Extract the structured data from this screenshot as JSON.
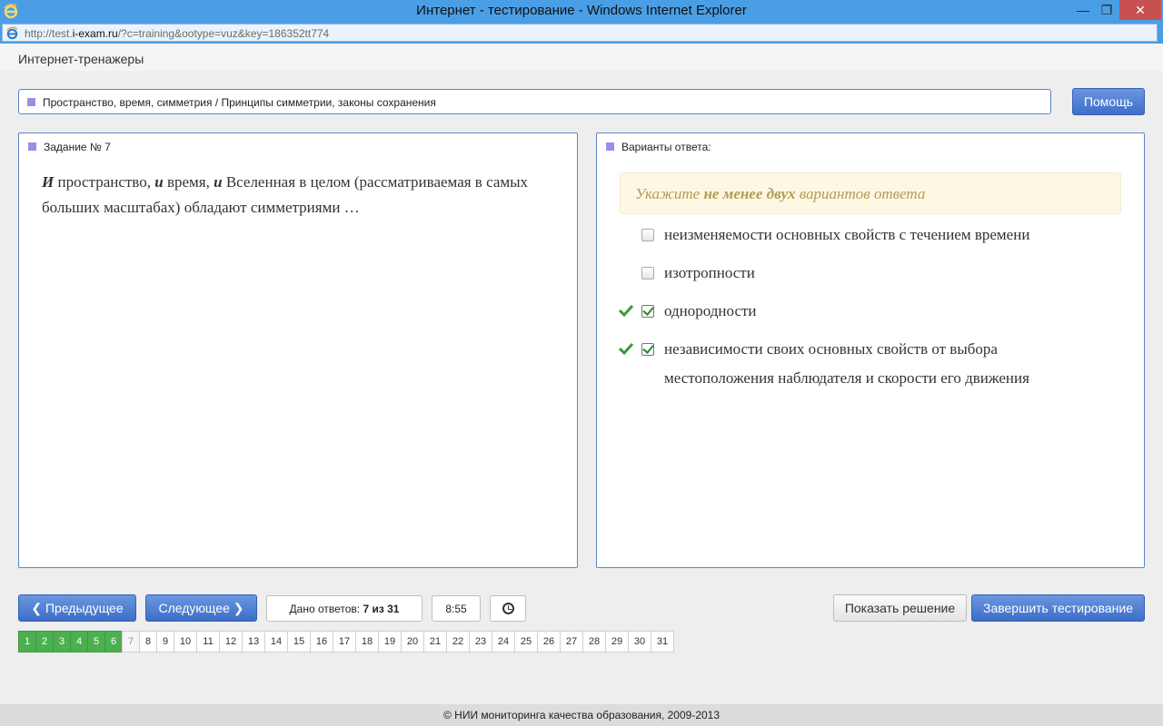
{
  "window": {
    "title": "Интернет - тестирование - Windows Internet Explorer",
    "min_glyph": "—",
    "max_glyph": "❐",
    "close_glyph": "✕",
    "icon": "ie-icon"
  },
  "address_bar": {
    "url_prefix": "http://test.",
    "url_host": "i-exam.ru",
    "url_rest": "/?c=training&ootype=vuz&key=186352tt774"
  },
  "app": {
    "title": "Интернет-тренажеры"
  },
  "topic": {
    "text": "Пространство, время, симметрия / Принципы симметрии, законы сохранения"
  },
  "help_button": {
    "label": "Помощь"
  },
  "task": {
    "header": "Задание № 7",
    "text_parts": [
      "И",
      " пространство, ",
      "и",
      " время, ",
      "и",
      " Вселенная в целом (рассматриваемая в самых больших масштабах) обладают симметриями …"
    ]
  },
  "answers": {
    "header": "Варианты ответа:",
    "hint_prefix": "Укажите ",
    "hint_bold": "не менее двух",
    "hint_suffix": " вариантов ответа",
    "options": [
      {
        "label": "неизменяемости основных свойств с течением времени",
        "checked": false,
        "correct_mark": false
      },
      {
        "label": "изотропности",
        "checked": false,
        "correct_mark": false
      },
      {
        "label": "однородности",
        "checked": true,
        "correct_mark": true
      },
      {
        "label": "независимости своих основных свойств от выбора местоположения наблюдателя и скорости его движения",
        "checked": true,
        "correct_mark": true
      }
    ]
  },
  "nav": {
    "prev_label": "Предыдущее",
    "next_label": "Следующее",
    "answers_count_prefix": "Дано ответов: ",
    "answers_count_value": "7 из 31",
    "timer": "8:55",
    "solution_label": "Показать решение",
    "finish_label": "Завершить тестирование"
  },
  "pager": {
    "current": 7,
    "done": [
      1,
      2,
      3,
      4,
      5,
      6
    ],
    "pages": [
      "1",
      "2",
      "3",
      "4",
      "5",
      "6",
      "7",
      "8",
      "9",
      "10",
      "11",
      "12",
      "13",
      "14",
      "15",
      "16",
      "17",
      "18",
      "19",
      "20",
      "21",
      "22",
      "23",
      "24",
      "25",
      "26",
      "27",
      "28",
      "29",
      "30",
      "31"
    ]
  },
  "footer": {
    "text": "© НИИ мониторинга качества образования, 2009-2013"
  },
  "colors": {
    "accent": "#4a78cc",
    "done": "#4caf50",
    "hint_bg": "#fcf8e3",
    "hint_text": "#b39a55"
  }
}
